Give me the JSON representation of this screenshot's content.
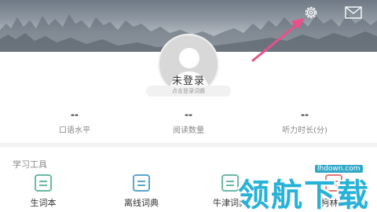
{
  "header": {
    "settings_icon": "gear-icon",
    "mail_icon": "mail-icon"
  },
  "profile": {
    "title": "未登录",
    "subtitle": "点击登录词霸"
  },
  "stats": [
    {
      "value": "--",
      "label": "口语水平"
    },
    {
      "value": "--",
      "label": "阅读数量"
    },
    {
      "value": "--",
      "label": "听力时长(分)"
    }
  ],
  "tools": {
    "section_title": "学习工具",
    "items": [
      {
        "label": "生词本",
        "icon": "notebook-icon"
      },
      {
        "label": "离线词典",
        "icon": "offline-dictionary-icon"
      },
      {
        "label": "牛津词典",
        "icon": "oxford-dictionary-icon"
      },
      {
        "label": "柯林斯",
        "icon": "collins-dictionary-icon"
      }
    ]
  },
  "watermark": {
    "url": "lhdown.com",
    "text": "领航下载"
  },
  "colors": {
    "arrow": "#e8508a",
    "accent_teal": "#6ab9a6",
    "accent_blue": "#5aa6c9",
    "accent_red": "#e07a7a",
    "watermark": "#1daed6"
  }
}
